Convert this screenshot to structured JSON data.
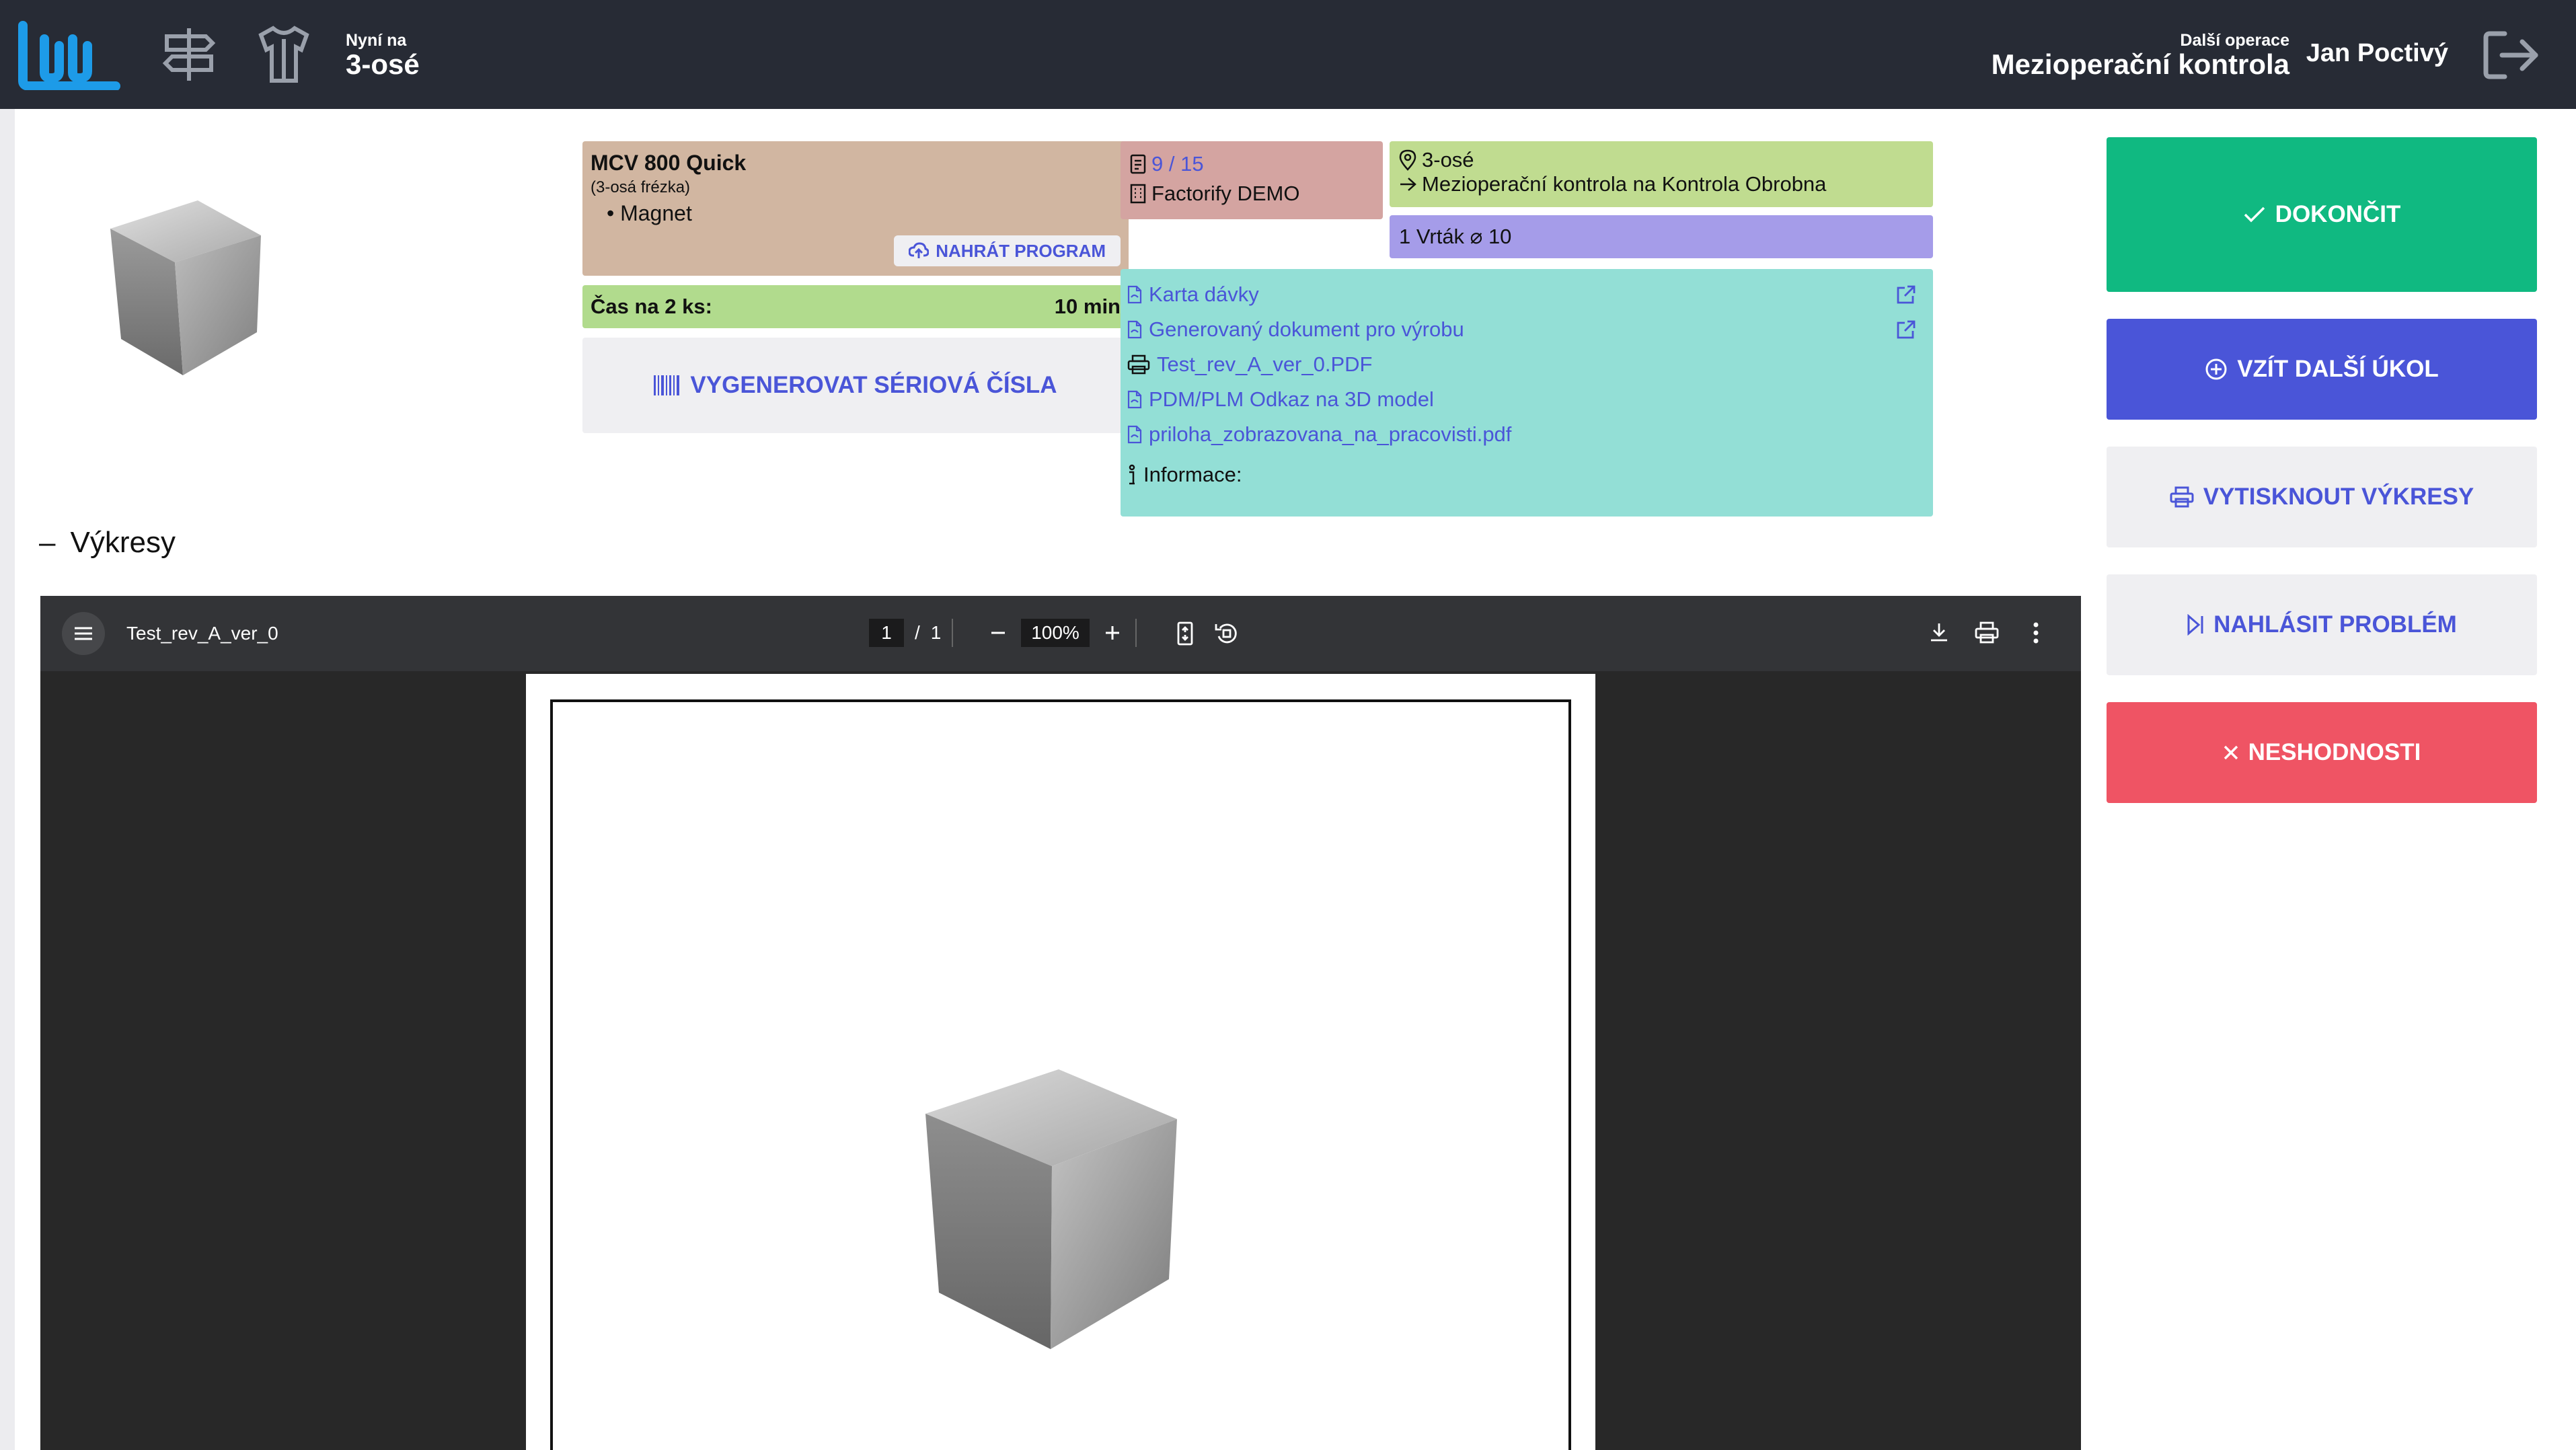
{
  "header": {
    "now_label": "Nyní na",
    "now_value": "3-osé",
    "next_label": "Další operace",
    "next_value": "Mezioperační kontrola",
    "user": "Jan Poctivý"
  },
  "machine": {
    "title": "MCV 800 Quick",
    "subtitle": "(3-osá frézka)",
    "bullet": "Magnet",
    "upload_label": "NAHRÁT PROGRAM"
  },
  "time": {
    "label": "Čas na 2 ks:",
    "value": "10 min"
  },
  "generate_label": "VYGENEROVAT SÉRIOVÁ ČÍSLA",
  "batch": {
    "count": "9 / 15",
    "company": "Factorify DEMO"
  },
  "location": {
    "current": "3-osé",
    "next": "Mezioperační kontrola na  Kontrola  Obrobna"
  },
  "tool": "1 Vrták ⌀ 10",
  "documents": {
    "items": [
      "Karta dávky",
      "Generovaný dokument pro výrobu",
      "Test_rev_A_ver_0.PDF",
      "PDM/PLM Odkaz na 3D model",
      "priloha_zobrazovana_na_pracovisti.pdf"
    ],
    "info_label": "Informace:"
  },
  "actions": {
    "finish": "DOKONČIT",
    "take_next": "VZÍT DALŠÍ ÚKOL",
    "print_drawings": "VYTISKNOUT VÝKRESY",
    "report_problem": "NAHLÁSIT PROBLÉM",
    "nonconformities": "NESHODNOSTI"
  },
  "section": {
    "toggle": "–",
    "title": "Výkresy"
  },
  "viewer": {
    "file_name": "Test_rev_A_ver_0",
    "page_current": "1",
    "page_separator": "/",
    "page_total": "1",
    "zoom": "100%"
  },
  "colors": {
    "topbar": "#272b35",
    "accent": "#4a55d8",
    "finish": "#10b981",
    "nonconformities": "#ef5464"
  },
  "icons": {
    "logo": "factorify-logo",
    "nav1": "signpost-icon",
    "nav2": "worker-icon",
    "logout": "logout-icon"
  }
}
